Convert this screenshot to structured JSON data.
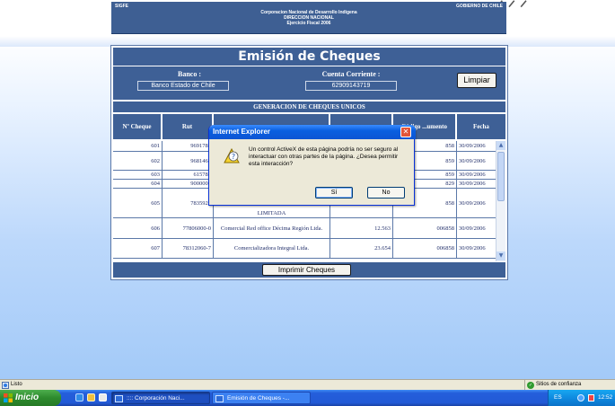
{
  "banner": {
    "left": "SIGFE",
    "right": "GOBIERNO DE CHILE",
    "line1": "Corporacion Nacional de Desarrollo Indigena",
    "line2": "DIRECCION NACIONAL",
    "line3": "Ejercicio Fiscal 2006"
  },
  "form": {
    "title": "Emisión de Cheques",
    "banco_label": "Banco :",
    "banco_value": "Banco Estado de Chile",
    "cuenta_label": "Cuenta Corriente :",
    "cuenta_value": "62909143719",
    "limpiar_button": "Limpiar",
    "section_title": "GENERACION DE CHEQUES UNICOS",
    "columns": {
      "cheque": "Nº Cheque",
      "rut": "Rut",
      "codigo": "Código ...umento",
      "fecha": "Fecha"
    },
    "imprimir_button": "Imprimir Cheques"
  },
  "rows": [
    {
      "cheque": "601",
      "rut": "9691781",
      "nombre": "",
      "monto": "",
      "codigo": "858",
      "fecha": "30/09/2006"
    },
    {
      "cheque": "602",
      "rut": "9681461",
      "nombre": "",
      "monto": "",
      "codigo": "859",
      "fecha": "30/09/2006"
    },
    {
      "cheque": "603",
      "rut": "615781",
      "nombre": "",
      "monto": "",
      "codigo": "859",
      "fecha": "30/09/2006"
    },
    {
      "cheque": "604",
      "rut": "9000000",
      "nombre": "",
      "monto": "",
      "codigo": "829",
      "fecha": "30/09/2006"
    },
    {
      "cheque": "605",
      "rut": "7835920",
      "nombre": "LIMITADA",
      "monto": "",
      "codigo": "858",
      "fecha": "30/09/2006"
    },
    {
      "cheque": "606",
      "rut": "77806000-0",
      "nombre": "Comercial Red office Décima Región Ltda.",
      "monto": "12.563",
      "codigo": "006858",
      "fecha": "30/09/2006"
    },
    {
      "cheque": "607",
      "rut": "78312060-7",
      "nombre": "Comercializadora Integral Ltda.",
      "monto": "23.654",
      "codigo": "006858",
      "fecha": "30/09/2006"
    }
  ],
  "dialog": {
    "title": "Internet Explorer",
    "message": "Un control ActiveX de esta página podría no ser seguro al interactuar con otras partes de la página. ¿Desea permitir esta interacción?",
    "yes": "Sí",
    "no": "No"
  },
  "statusbar": {
    "text": "Listo",
    "zone": "Sitios de confianza"
  },
  "taskbar": {
    "start": "Inicio",
    "task1": ":::: Corporación Naci...",
    "task2": "Emisión de Cheques -...",
    "lang": "ES",
    "time": "12:52"
  }
}
